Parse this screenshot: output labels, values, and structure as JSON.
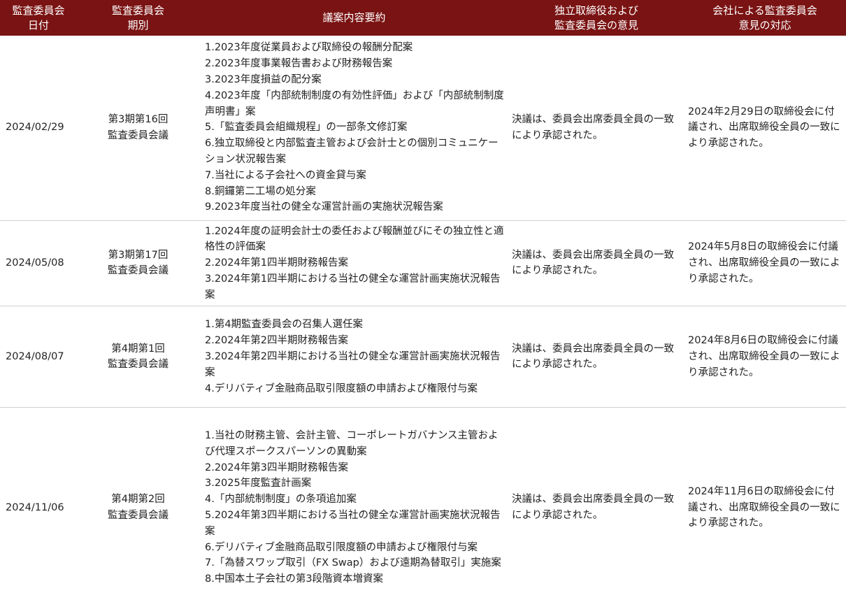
{
  "headers": {
    "date": [
      "監査委員会",
      "日付"
    ],
    "period": [
      "監査委員会",
      "期別"
    ],
    "agenda": [
      "議案内容要約"
    ],
    "opinion": [
      "独立取締役および",
      "監査委員会の意見"
    ],
    "response": [
      "会社による監査委員会",
      "意見の対応"
    ]
  },
  "rows": [
    {
      "date": "2024/02/29",
      "period": [
        "第3期第16回",
        "監査委員会議"
      ],
      "agenda": [
        "1.2023年度従業員および取締役の報酬分配案",
        "2.2023年度事業報告書および財務報告案",
        "3.2023年度損益の配分案",
        "4.2023年度「内部統制制度の有効性評価」および「内部統制制度声明書」案",
        "5.「監査委員会組織規程」の一部条文修訂案",
        "6.独立取締役と内部監査主管および会計士との個別コミュニケーション状況報告案",
        "7.当社による子会社への資金貸与案",
        "8.銅鑼第二工場の処分案",
        "9.2023年度当社の健全な運営計画の実施状況報告案"
      ],
      "opinion": "決議は、委員会出席委員全員の一致により承認された。",
      "response": "2024年2月29日の取締役会に付議され、出席取締役全員の一致により承認された。"
    },
    {
      "date": "2024/05/08",
      "period": [
        "第3期第17回",
        "監査委員会議"
      ],
      "agenda": [
        "1.2024年度の証明会計士の委任および報酬並びにその独立性と適格性の評価案",
        "2.2024年第1四半期財務報告案",
        "3.2024年第1四半期における当社の健全な運営計画実施状況報告案"
      ],
      "opinion": "決議は、委員会出席委員全員の一致により承認された。",
      "response": "2024年5月8日の取締役会に付議され、出席取締役全員の一致により承認された。"
    },
    {
      "date": "2024/08/07",
      "period": [
        "第4期第1回",
        "監査委員会議"
      ],
      "agenda": [
        "1.第4期監査委員会の召集人選任案",
        "2.2024年第2四半期財務報告案",
        "3.2024年第2四半期における当社の健全な運営計画実施状況報告案",
        "4.デリバティブ金融商品取引限度額の申請および権限付与案"
      ],
      "opinion": "決議は、委員会出席委員全員の一致により承認された。",
      "response": "2024年8月6日の取締役会に付議され、出席取締役全員の一致により承認された。"
    },
    {
      "date": "2024/11/06",
      "period": [
        "第4期第2回",
        "監査委員会議"
      ],
      "agenda": [
        "1.当社の財務主管、会計主管、コーポレートガバナンス主管および代理スポークスパーソンの異動案",
        "2.2024年第3四半期財務報告案",
        "3.2025年度監査計画案",
        "4.「内部統制制度」の条項追加案",
        "5.2024年第3四半期における当社の健全な運営計画実施状況報告案",
        "6.デリバティブ金融商品取引限度額の申請および権限付与案",
        "7.「為替スワップ取引（FX Swap）および遠期為替取引」実施案",
        "8.中国本土子会社の第3段階資本増資案"
      ],
      "opinion": "決議は、委員会出席委員全員の一致により承認された。",
      "response": "2024年11月6日の取締役会に付議され、出席取締役全員の一致により承認された。"
    }
  ]
}
